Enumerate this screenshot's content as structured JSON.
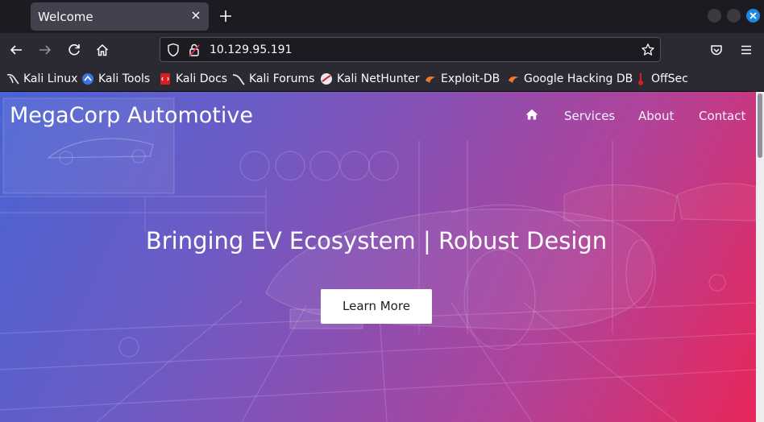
{
  "browser": {
    "tab_title": "Welcome",
    "url": "10.129.95.191",
    "bookmarks": [
      {
        "label": "Kali Linux",
        "icon": "kali-dragon-icon"
      },
      {
        "label": "Kali Tools",
        "icon": "kali-tools-icon"
      },
      {
        "label": "Kali Docs",
        "icon": "kali-docs-icon"
      },
      {
        "label": "Kali Forums",
        "icon": "kali-forums-icon"
      },
      {
        "label": "Kali NetHunter",
        "icon": "nethunter-icon"
      },
      {
        "label": "Exploit-DB",
        "icon": "exploit-db-icon"
      },
      {
        "label": "Google Hacking DB",
        "icon": "ghdb-icon"
      },
      {
        "label": "OffSec",
        "icon": "offsec-icon"
      }
    ]
  },
  "page": {
    "brand": "MegaCorp Automotive",
    "nav": {
      "home_icon": "home-icon",
      "services": "Services",
      "about": "About",
      "contact": "Contact"
    },
    "headline": "Bringing EV Ecosystem | Robust Design",
    "cta_label": "Learn More"
  },
  "colors": {
    "gradient_start": "#4a63d3",
    "gradient_end": "#e8265a",
    "browser_bg": "#1c1b22",
    "toolbar_bg": "#2b2a33"
  }
}
